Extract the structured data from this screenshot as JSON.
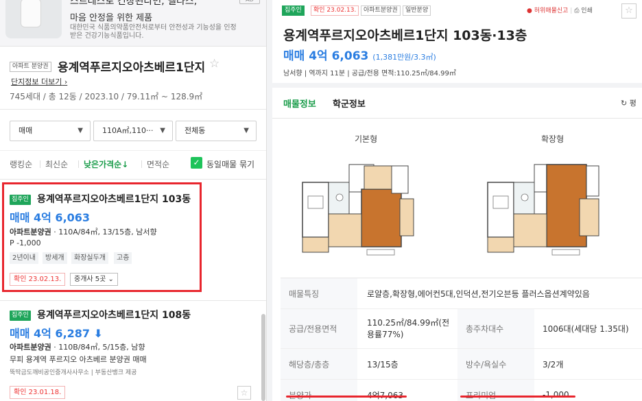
{
  "ad": {
    "title": "스트레스로 긴장된다면, 델타스,",
    "subtitle": "마음 안정을 위한 제품",
    "description": "대한민국 식품의약품안전처로부터 안전성과 기능성을 인정받은 건강기능식품입니다.",
    "badge": "AD"
  },
  "complex": {
    "tag": "아파트 분양권",
    "name": "용계역푸르지오아츠베르1단지",
    "link": "단지정보 더보기",
    "info": "745세대 / 총 12동 / 2023.10 / 79.11㎡ ~ 128.9㎡"
  },
  "filters": {
    "trade": "매매",
    "area": "110A㎡,110···",
    "dong": "전체동"
  },
  "sort": {
    "ranking": "랭킹순",
    "latest": "최신순",
    "low_price": "낮은가격순↓",
    "area": "면적순",
    "group_label": "동일매물 묶기"
  },
  "listings": [
    {
      "tag": "집주인",
      "title": "용계역푸르지오아츠베르1단지 103동",
      "price": "매매 4억 6,063",
      "detail_type": "아파트분양권",
      "detail": " · 110A/84㎡, 13/15층, 남서향",
      "extra": "P -1,000",
      "chips": [
        "2년이내",
        "방세개",
        "화장실두개",
        "고층"
      ],
      "confirm": "확인 23.02.13.",
      "agents": "중개사 5곳"
    },
    {
      "tag": "집주인",
      "title": "용계역푸르지오아츠베르1단지 108동",
      "price": "매매 4억 6,287",
      "detail_type": "아파트분양권",
      "detail": " · 110B/84㎡, 5/15층, 남향",
      "extra": "무피 용계역 푸르지오 아츠베르 분양권 매매",
      "source": "뚝딱금도깨비공인중개사사무소 | 부동산뱅크 제공",
      "confirm": "확인 23.01.18."
    }
  ],
  "detail": {
    "tags": [
      "집주인",
      "확인 23.02.13.",
      "아파트분양권",
      "일반분양"
    ],
    "report": "허위매물신고",
    "print": "인쇄",
    "title": "용계역푸르지오아츠베르1단지 103동·13층",
    "price": "매매 4억 6,063",
    "price_per": "(1,381만원/3.3㎡)",
    "meta": "남서향 | 역까지 11분 | 공급/전용 면적:110.25㎡/84.99㎡",
    "tab_info": "매물정보",
    "tab_school": "학군정보",
    "refresh": "평",
    "plan_basic": "기본형",
    "plan_extended": "확장형",
    "table": {
      "feature_label": "매물특징",
      "feature_value": "로얄층,확장형,에어컨5대,인덕션,전기오븐등 플러스옵션계약있음",
      "area_label": "공급/전용면적",
      "area_value": "110.25㎡/84.99㎡(전용률77%)",
      "households_label": "총주차대수",
      "households_value": "1006대(세대당 1.35대)",
      "floor_label": "해당층/총층",
      "floor_value": "13/15층",
      "rooms_label": "방수/욕실수",
      "rooms_value": "3/2개",
      "sale_label": "분양가",
      "sale_value": "4억7,063",
      "premium_label": "프리미엄",
      "premium_value": "-1,000"
    }
  }
}
